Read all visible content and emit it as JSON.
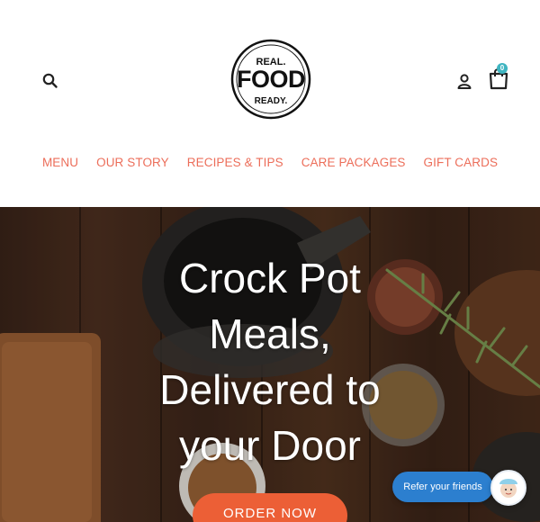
{
  "header": {
    "logo": {
      "top_text": "REAL.",
      "main_text": "FOOD",
      "bottom_text": "READY."
    },
    "search_icon": "search-icon",
    "account_icon": "user-icon",
    "cart_icon": "shopping-bag-icon",
    "cart_count": "0"
  },
  "nav": {
    "items": [
      {
        "label": "MENU"
      },
      {
        "label": "OUR STORY"
      },
      {
        "label": "RECIPES & TIPS"
      },
      {
        "label": "CARE PACKAGES"
      },
      {
        "label": "GIFT CARDS"
      }
    ],
    "color": "#ec6e5a"
  },
  "hero": {
    "title_lines": [
      "Crock Pot",
      "Meals,",
      "Delivered to",
      "your Door"
    ],
    "cta_label": "ORDER NOW",
    "cta_color": "#ec5f36"
  },
  "refer": {
    "label": "Refer your friends",
    "color": "#2c7fcf"
  }
}
